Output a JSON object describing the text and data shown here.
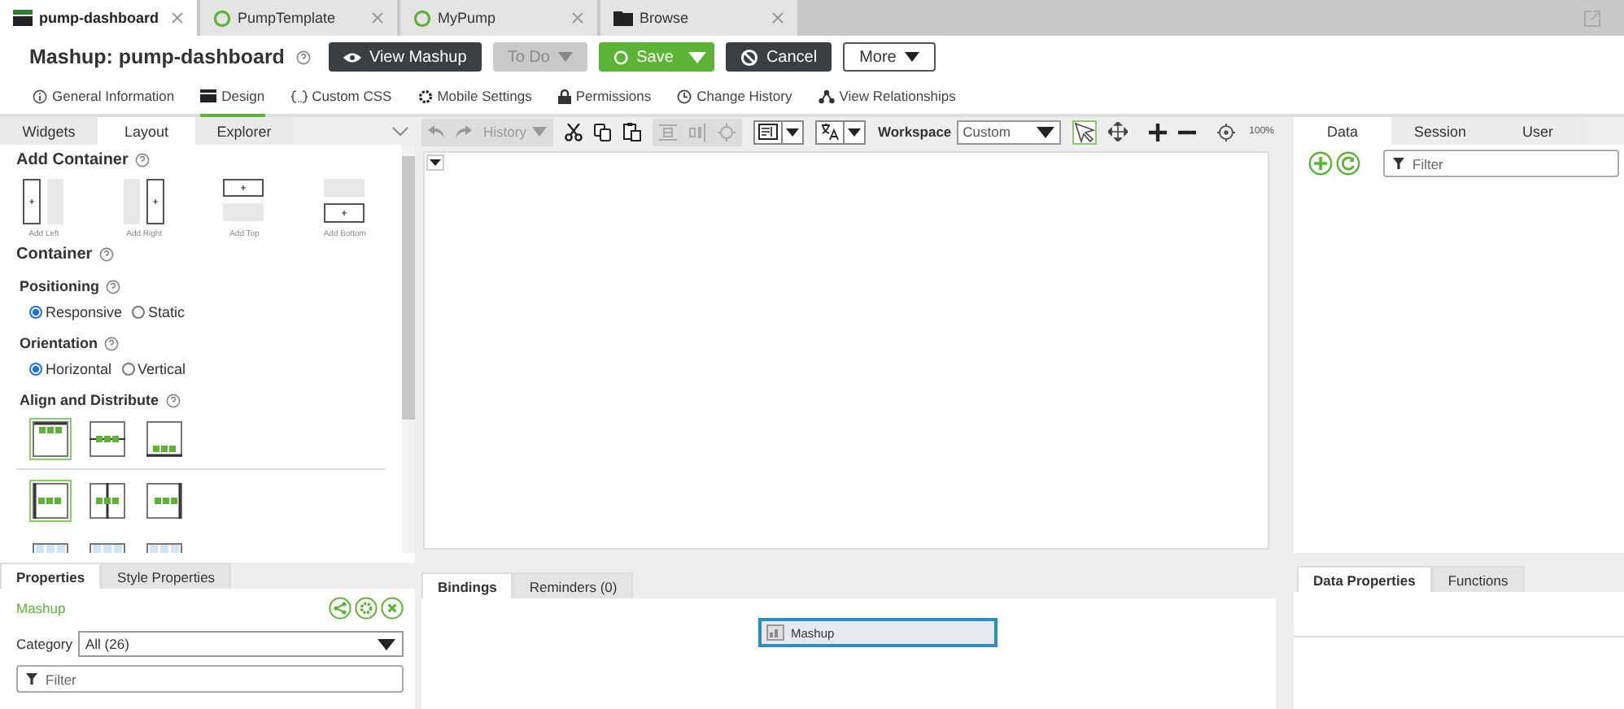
{
  "editor_tabs": [
    {
      "label": "pump-dashboard",
      "kind": "mashup",
      "selected": true
    },
    {
      "label": "PumpTemplate",
      "kind": "thing",
      "selected": false
    },
    {
      "label": "MyPump",
      "kind": "thing",
      "selected": false
    },
    {
      "label": "Browse",
      "kind": "browse",
      "selected": false
    }
  ],
  "header": {
    "title": "Mashup: pump-dashboard",
    "buttons": [
      {
        "label": "View Mashup",
        "kind": "dark"
      },
      {
        "label": "To Do",
        "kind": "disabled"
      },
      {
        "label": "Save",
        "kind": "primary"
      },
      {
        "label": "Cancel",
        "kind": "dark"
      },
      {
        "label": "More",
        "kind": "outline"
      }
    ]
  },
  "nav_tabs": [
    {
      "label": "General Information",
      "selected": false
    },
    {
      "label": "Design",
      "selected": true
    },
    {
      "label": "Custom CSS",
      "selected": false
    },
    {
      "label": "Mobile Settings",
      "selected": false
    },
    {
      "label": "Permissions",
      "selected": false
    },
    {
      "label": "Change History",
      "selected": false
    },
    {
      "label": "View Relationships",
      "selected": false
    }
  ],
  "left_panel": {
    "tabs": [
      {
        "label": "Widgets",
        "selected": false
      },
      {
        "label": "Layout",
        "selected": true
      },
      {
        "label": "Explorer",
        "selected": false
      }
    ],
    "add_container": {
      "title": "Add Container",
      "options": [
        "Add Left",
        "Add Right",
        "Add Top",
        "Add Bottom"
      ]
    },
    "container_title": "Container",
    "positioning": {
      "label": "Positioning",
      "options": [
        {
          "label": "Responsive",
          "selected": true
        },
        {
          "label": "Static",
          "selected": false
        }
      ]
    },
    "orientation": {
      "label": "Orientation",
      "options": [
        {
          "label": "Horizontal",
          "selected": true
        },
        {
          "label": "Vertical",
          "selected": false
        }
      ]
    },
    "align_title": "Align and Distribute",
    "align_rows": [
      [
        {
          "kind": "top",
          "selected": true
        },
        {
          "kind": "middle",
          "selected": false
        },
        {
          "kind": "bottom",
          "selected": false
        }
      ],
      [
        {
          "kind": "left",
          "selected": true
        },
        {
          "kind": "center",
          "selected": false
        },
        {
          "kind": "right",
          "selected": false
        }
      ],
      [
        {
          "kind": "spread",
          "selected": false
        },
        {
          "kind": "spread",
          "selected": false
        },
        {
          "kind": "spread",
          "selected": false
        }
      ]
    ]
  },
  "toolbar": {
    "history": "History",
    "workspace_label": "Workspace",
    "workspace_value": "Custom",
    "zoom": "100%"
  },
  "right_panel": {
    "tabs": [
      {
        "label": "Data",
        "selected": true
      },
      {
        "label": "Session",
        "selected": false
      },
      {
        "label": "User",
        "selected": false
      }
    ],
    "filter_placeholder": "Filter"
  },
  "properties": {
    "tabs": [
      {
        "label": "Properties",
        "selected": true
      },
      {
        "label": "Style Properties",
        "selected": false
      }
    ],
    "name": "Mashup",
    "category_label": "Category",
    "category_value": "All (26)",
    "filter_placeholder": "Filter"
  },
  "bindings": {
    "tabs": [
      {
        "label": "Bindings",
        "selected": true
      },
      {
        "label": "Reminders (0)",
        "selected": false
      }
    ],
    "node": "Mashup"
  },
  "data_properties": {
    "tabs": [
      {
        "label": "Data Properties",
        "selected": true
      },
      {
        "label": "Functions",
        "selected": false
      }
    ]
  }
}
